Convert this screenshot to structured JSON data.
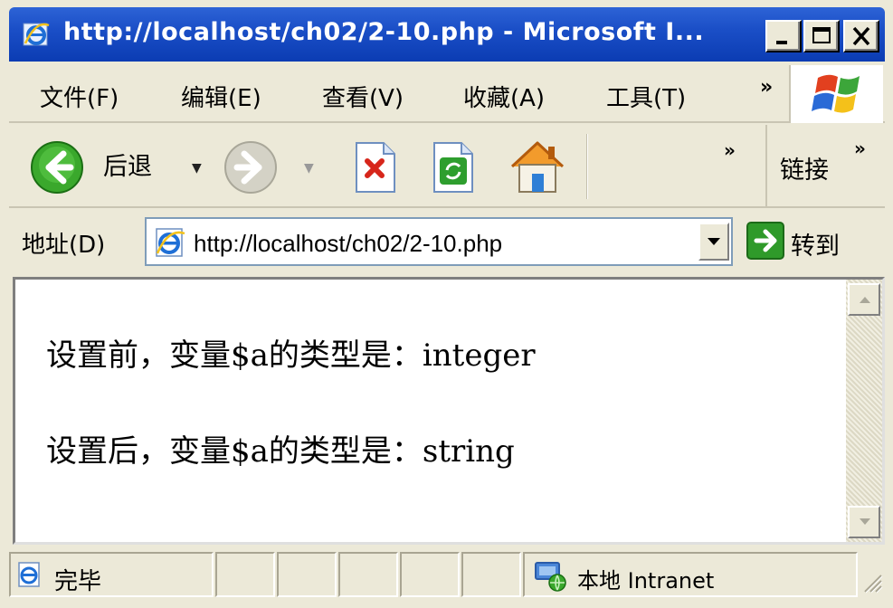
{
  "window": {
    "title": "http://localhost/ch02/2-10.php - Microsoft I...",
    "controls": {
      "minimize": "minimize",
      "maximize": "maximize",
      "close": "close"
    }
  },
  "menubar": {
    "items": [
      {
        "label": "文件(F)"
      },
      {
        "label": "编辑(E)"
      },
      {
        "label": "查看(V)"
      },
      {
        "label": "收藏(A)"
      },
      {
        "label": "工具(T)"
      }
    ],
    "overflow": "»"
  },
  "toolbar": {
    "back_label": "后退",
    "overflow": "»",
    "links_label": "链接",
    "links_overflow": "»"
  },
  "addressbar": {
    "label": "地址(D)",
    "url": "http://localhost/ch02/2-10.php",
    "go_label": "转到"
  },
  "content": {
    "lines": [
      "设置前，变量$a的类型是：integer",
      "设置后，变量$a的类型是：string"
    ]
  },
  "statusbar": {
    "status_text": "完毕",
    "zone_text": "本地 Intranet"
  },
  "colors": {
    "titlebar": "#0b3cb3",
    "chrome": "#ece9d8",
    "back_green": "#2e9e1f",
    "go_green": "#2f9a2a"
  },
  "icons": [
    "ie-icon",
    "minimize-icon",
    "maximize-icon",
    "close-icon",
    "windows-logo-icon",
    "back-icon",
    "forward-icon",
    "stop-icon",
    "refresh-icon",
    "home-icon",
    "page-icon",
    "go-icon",
    "intranet-icon"
  ]
}
